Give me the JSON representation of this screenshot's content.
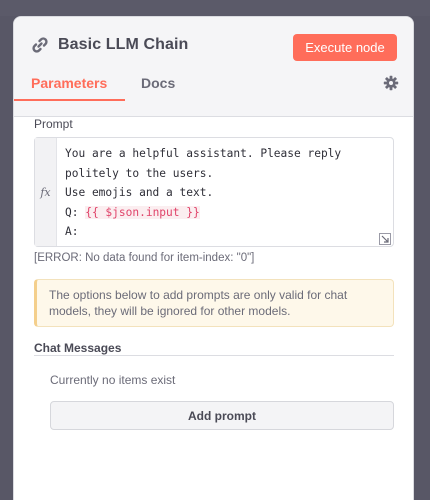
{
  "node": {
    "title": "Basic LLM Chain",
    "title_icon": "link-icon",
    "execute_label": "Execute node"
  },
  "tabs": [
    {
      "label": "Parameters",
      "active": true
    },
    {
      "label": "Docs",
      "active": false
    }
  ],
  "settings_icon": "gear-icon",
  "prompt": {
    "label": "Prompt",
    "fx_label": "fx",
    "lines": [
      "You are a helpful assistant. Please reply",
      "politely to the users.",
      "Use emojis and a text.",
      "Q: ",
      "A:"
    ],
    "expression": "{{ $json.input }}",
    "error": "[ERROR: No data found for item-index: \"0\"]"
  },
  "notice": "The options below to add prompts are only valid for chat models, they will be ignored for other models.",
  "chat_messages": {
    "label": "Chat Messages",
    "empty_text": "Currently no items exist",
    "add_label": "Add prompt"
  },
  "colors": {
    "accent": "#ff6d5a",
    "notice_bg": "#fef8ea",
    "expression": "#e0446a"
  }
}
